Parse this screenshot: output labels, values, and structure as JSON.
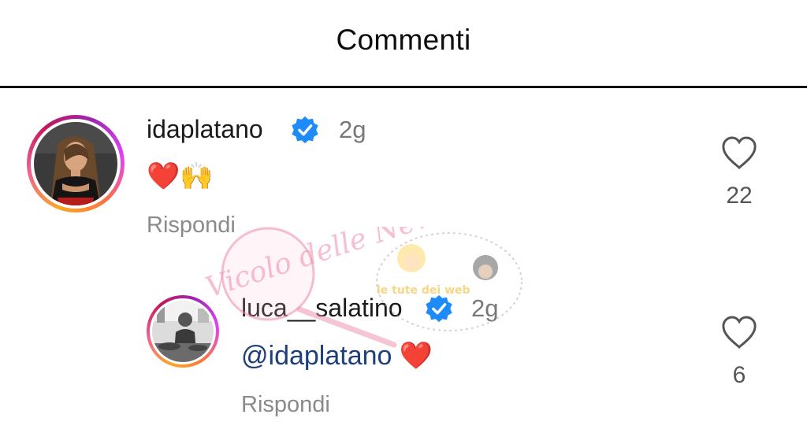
{
  "header": {
    "title": "Commenti"
  },
  "comments": [
    {
      "username": "idaplatano",
      "time": "2g",
      "text": "❤️🙌",
      "reply_label": "Rispondi",
      "likes": "22"
    },
    {
      "username": "luca__salatino",
      "time": "2g",
      "mention": "@idaplatano",
      "text": "❤️",
      "reply_label": "Rispondi",
      "likes": "6"
    }
  ],
  "watermark": {
    "text": "Vicolo delle News",
    "caption": "le tute dei web"
  },
  "colors": {
    "verified": "#1d8cf8",
    "mention": "#1e3f7a",
    "secondary_text": "#8a8a8a"
  }
}
